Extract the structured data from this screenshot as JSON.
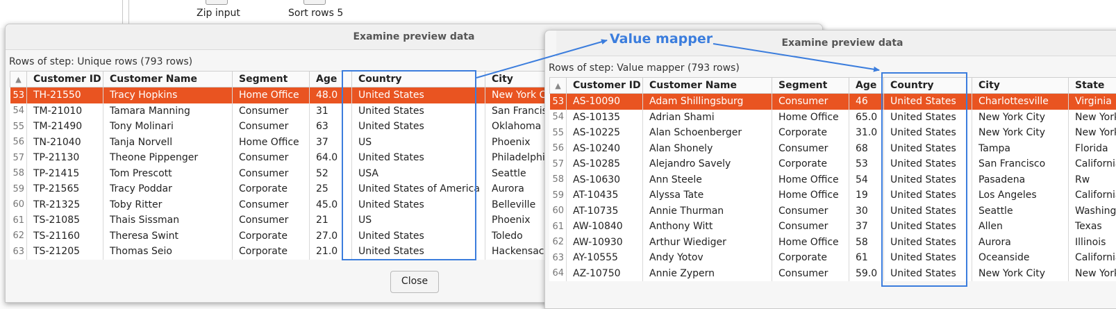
{
  "background": {
    "steps": [
      {
        "label": "Zip input"
      },
      {
        "label": "Sort rows 5"
      }
    ]
  },
  "left_dialog": {
    "title": "Examine preview data",
    "rows_label": "Rows of step: Unique rows (793 rows)",
    "columns": [
      "Customer ID",
      "Customer Name",
      "Segment",
      "Age",
      "Country",
      "City"
    ],
    "rows": [
      {
        "idx": "53",
        "cells": [
          "TH-21550",
          "Tracy Hopkins",
          "Home Office",
          "48.0",
          "United States",
          "New York City"
        ],
        "selected": true
      },
      {
        "idx": "54",
        "cells": [
          "TM-21010",
          "Tamara Manning",
          "Consumer",
          "31",
          "United States",
          "San Francisco"
        ]
      },
      {
        "idx": "55",
        "cells": [
          "TM-21490",
          "Tony Molinari",
          "Consumer",
          "63",
          "United States",
          "Oklahoma City"
        ]
      },
      {
        "idx": "56",
        "cells": [
          "TN-21040",
          "Tanja Norvell",
          "Home Office",
          "37",
          "US",
          "Phoenix"
        ]
      },
      {
        "idx": "57",
        "cells": [
          "TP-21130",
          "Theone Pippenger",
          "Consumer",
          "64.0",
          "United States",
          "Philadelphia"
        ]
      },
      {
        "idx": "58",
        "cells": [
          "TP-21415",
          "Tom Prescott",
          "Consumer",
          "52",
          "USA",
          "Seattle"
        ]
      },
      {
        "idx": "59",
        "cells": [
          "TP-21565",
          "Tracy Poddar",
          "Corporate",
          "25",
          "United States of America",
          "Aurora"
        ]
      },
      {
        "idx": "60",
        "cells": [
          "TR-21325",
          "Toby Ritter",
          "Consumer",
          "45.0",
          "United States",
          "Belleville"
        ]
      },
      {
        "idx": "61",
        "cells": [
          "TS-21085",
          "Thais Sissman",
          "Consumer",
          "21",
          "US",
          "Phoenix"
        ]
      },
      {
        "idx": "62",
        "cells": [
          "TS-21160",
          "Theresa Swint",
          "Corporate",
          "27.0",
          "United States",
          "Toledo"
        ]
      },
      {
        "idx": "63",
        "cells": [
          "TS-21205",
          "Thomas Seio",
          "Corporate",
          "21.0",
          "United States",
          "Hackensack"
        ]
      }
    ],
    "close_label": "Close"
  },
  "right_dialog": {
    "title": "Examine preview data",
    "rows_label": "Rows of step: Value mapper (793 rows)",
    "columns": [
      "Customer ID",
      "Customer Name",
      "Segment",
      "Age",
      "Country",
      "City",
      "State"
    ],
    "rows": [
      {
        "idx": "53",
        "cells": [
          "AS-10090",
          "Adam Shillingsburg",
          "Consumer",
          "46",
          "United States",
          "Charlottesville",
          "Virginia"
        ],
        "selected": true
      },
      {
        "idx": "54",
        "cells": [
          "AS-10135",
          "Adrian Shami",
          "Home Office",
          "65.0",
          "United States",
          "New York City",
          "New York"
        ]
      },
      {
        "idx": "55",
        "cells": [
          "AS-10225",
          "Alan Schoenberger",
          "Corporate",
          "31.0",
          "United States",
          "New York City",
          "New York"
        ]
      },
      {
        "idx": "56",
        "cells": [
          "AS-10240",
          "Alan Shonely",
          "Consumer",
          "68",
          "United States",
          "Tampa",
          "Florida"
        ]
      },
      {
        "idx": "57",
        "cells": [
          "AS-10285",
          "Alejandro Savely",
          "Corporate",
          "53",
          "United States",
          "San Francisco",
          "California"
        ]
      },
      {
        "idx": "58",
        "cells": [
          "AS-10630",
          "Ann Steele",
          "Home Office",
          "54",
          "United States",
          "Pasadena",
          "Rw"
        ]
      },
      {
        "idx": "59",
        "cells": [
          "AT-10435",
          "Alyssa Tate",
          "Home Office",
          "19",
          "United States",
          "Los Angeles",
          "California"
        ]
      },
      {
        "idx": "60",
        "cells": [
          "AT-10735",
          "Annie Thurman",
          "Consumer",
          "30",
          "United States",
          "Seattle",
          "Washington"
        ]
      },
      {
        "idx": "61",
        "cells": [
          "AW-10840",
          "Anthony Witt",
          "Consumer",
          "37",
          "United States",
          "Allen",
          "Texas"
        ]
      },
      {
        "idx": "62",
        "cells": [
          "AW-10930",
          "Arthur Wiediger",
          "Home Office",
          "58",
          "United States",
          "Aurora",
          "Illinois"
        ]
      },
      {
        "idx": "63",
        "cells": [
          "AY-10555",
          "Andy Yotov",
          "Corporate",
          "61",
          "United States",
          "Oceanside",
          "California"
        ]
      },
      {
        "idx": "64",
        "cells": [
          "AZ-10750",
          "Annie Zypern",
          "Consumer",
          "59.0",
          "United States",
          "New York City",
          "New York"
        ]
      }
    ]
  },
  "annotation": {
    "label": "Value mapper",
    "color": "#3b7ddd"
  },
  "colors": {
    "selection": "#e95421",
    "highlight": "#3b7ddd"
  }
}
